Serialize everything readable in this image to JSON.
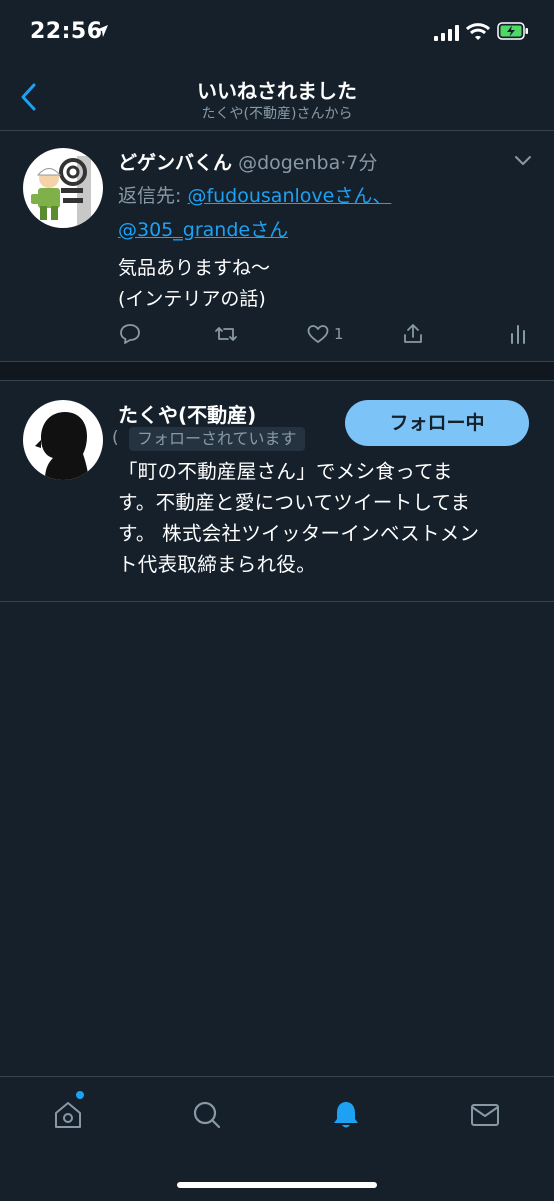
{
  "status_bar": {
    "time": "22:56"
  },
  "nav": {
    "title": "いいねされました",
    "subtitle": "たくや(不動産)さんから"
  },
  "tweet": {
    "display_name": "どゲンバくん",
    "handle": "@dogenba",
    "separator": "·",
    "time": "7分",
    "reply_prefix": "返信先: ",
    "mention1": "@fudousanloveさん、",
    "mention2": "@305_grandeさん",
    "text_line1": "気品ありますね〜",
    "text_line2": "(インテリアの話)",
    "like_count": "1"
  },
  "profile": {
    "name": "たくや(不動産)",
    "follows_you": "フォローされています",
    "paren_fragment": "(",
    "follow_button_label": "フォロー中",
    "bio_line1": "「町の不動産屋さん」でメシ食ってま",
    "bio_line2": "す。不動産と愛についてツイートしてま",
    "bio_line3": "す。 株式会社ツイッターインベストメン",
    "bio_line4": "ト代表取締まられ役。"
  },
  "icons": {
    "accent": "#1da1f2",
    "secondary_text": "#8899a6",
    "background": "#15202b",
    "names": [
      "back-icon",
      "caret-down-icon",
      "reply-icon",
      "retweet-icon",
      "like-icon",
      "share-icon",
      "analytics-icon",
      "home-icon",
      "search-icon",
      "notifications-icon",
      "messages-icon"
    ]
  }
}
